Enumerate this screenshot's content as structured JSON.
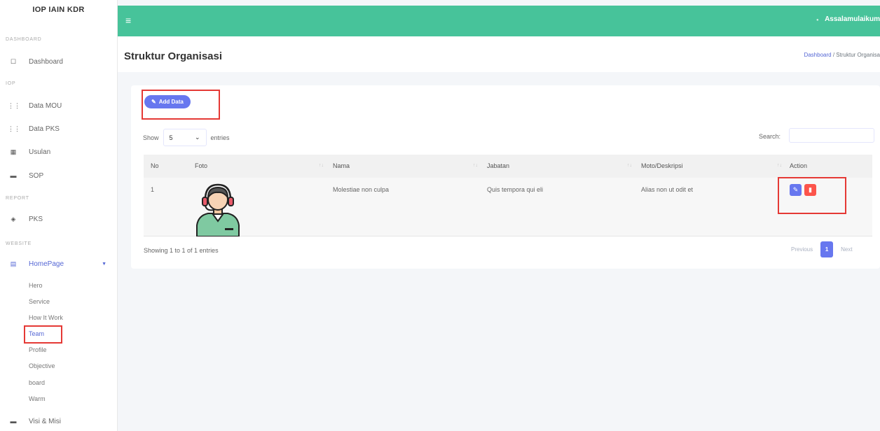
{
  "app": {
    "brand": "IOP IAIN KDR"
  },
  "topbar": {
    "greeting": "Assalamulaikum"
  },
  "sidebar": {
    "sections": [
      {
        "label": "DASHBOARD"
      },
      {
        "label": "IOP"
      },
      {
        "label": "REPORT"
      },
      {
        "label": "WEBSITE"
      }
    ],
    "items": [
      {
        "label": "Dashboard",
        "icon": "square-icon"
      },
      {
        "label": "Data MOU",
        "icon": "network-icon"
      },
      {
        "label": "Data PKS",
        "icon": "network-icon"
      },
      {
        "label": "Usulan",
        "icon": "people-icon"
      },
      {
        "label": "SOP",
        "icon": "book-icon"
      },
      {
        "label": "PKS",
        "icon": "eye-icon"
      },
      {
        "label": "HomePage",
        "icon": "home-icon"
      },
      {
        "label": "Visi & Misi",
        "icon": "book-icon"
      }
    ],
    "homepage_sub": [
      "Hero",
      "Service",
      "How It Work",
      "Team",
      "Profile",
      "Objective",
      "board",
      "Warm"
    ]
  },
  "page": {
    "title": "Struktur Organisasi",
    "breadcrumb_link": "Dashboard",
    "breadcrumb_sep": "/",
    "breadcrumb_current": "Struktur Organisa"
  },
  "toolbar": {
    "add_label": "Add Data",
    "show_label": "Show",
    "entries_value": "5",
    "entries_label": "entries",
    "search_label": "Search:",
    "search_value": ""
  },
  "table": {
    "headers": [
      "No",
      "Foto",
      "Nama",
      "Jabatan",
      "Moto/Deskripsi",
      "Action"
    ],
    "rows": [
      {
        "no": "1",
        "nama": "Molestiae non culpa",
        "jabatan": "Quis tempora qui eli",
        "moto": "Alias non ut odit et"
      }
    ],
    "info": "Showing 1 to 1 of 1 entries",
    "pagination": {
      "previous": "Previous",
      "current": "1",
      "next": "Next"
    }
  },
  "colors": {
    "topbar": "#47c39a",
    "primary": "#6777ef",
    "danger": "#fc544b",
    "highlight": "#e53935"
  }
}
